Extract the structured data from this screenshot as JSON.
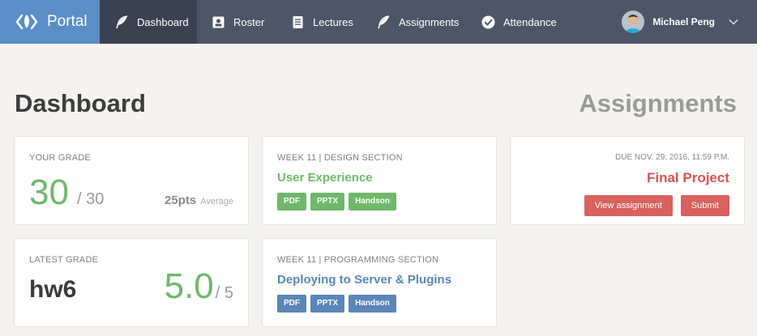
{
  "brand": {
    "label": "Portal"
  },
  "nav": [
    {
      "label": "Dashboard",
      "icon": "feather-icon",
      "active": true
    },
    {
      "label": "Roster",
      "icon": "contact-card-icon"
    },
    {
      "label": "Lectures",
      "icon": "document-icon"
    },
    {
      "label": "Assignments",
      "icon": "feather-icon"
    },
    {
      "label": "Attendance",
      "icon": "check-circle-icon"
    }
  ],
  "user": {
    "name": "Michael Peng"
  },
  "page_title": "Dashboard",
  "assignments_heading": "Assignments",
  "grade": {
    "caption": "YOUR GRADE",
    "value": "30",
    "total": "/ 30",
    "average_value": "25pts",
    "average_label": "Average"
  },
  "latest": {
    "caption": "LATEST GRADE",
    "name": "hw6",
    "value": "5.0",
    "total": "/ 5"
  },
  "lectures": [
    {
      "caption": "WEEK 11 | DESIGN SECTION",
      "title": "User Experience",
      "color": "#6fb86b",
      "chips": [
        "PDF",
        "PPTX",
        "Handson"
      ]
    },
    {
      "caption": "WEEK 11 | PROGRAMMING SECTION",
      "title": "Deploying to Server & Plugins",
      "color": "#5a86b8",
      "chips": [
        "PDF",
        "PPTX",
        "Handson"
      ]
    }
  ],
  "assignment": {
    "due": "DUE NOV. 29, 2016, 11:59 P.M.",
    "title": "Final Project",
    "view_label": "View assignment",
    "submit_label": "Submit"
  },
  "colors": {
    "nav_bg": "#4c5666",
    "brand_bg": "#5b8ec7",
    "green": "#6fb86b",
    "blue": "#5a86b8",
    "red": "#d9615e"
  }
}
